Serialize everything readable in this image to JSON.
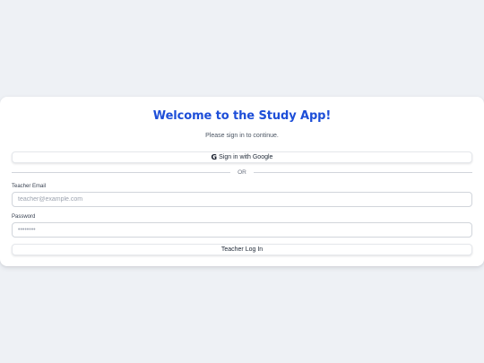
{
  "login": {
    "title": "Welcome to the Study App!",
    "subtitle": "Please sign in to continue.",
    "google_button_label": "Sign in with Google",
    "google_icon_glyph": "G",
    "divider_text": "OR",
    "email_label": "Teacher Email",
    "email_placeholder": "teacher@example.com",
    "email_value": "",
    "password_label": "Password",
    "password_placeholder": "••••••••",
    "password_value": "",
    "login_button_label": "Teacher Log In"
  },
  "theme": {
    "page_background": "#eef1f5",
    "card_background": "#ffffff",
    "title_color": "#1d4ed8",
    "border_color": "#d1d5db"
  },
  "icons": {
    "google": "google-g-icon"
  }
}
